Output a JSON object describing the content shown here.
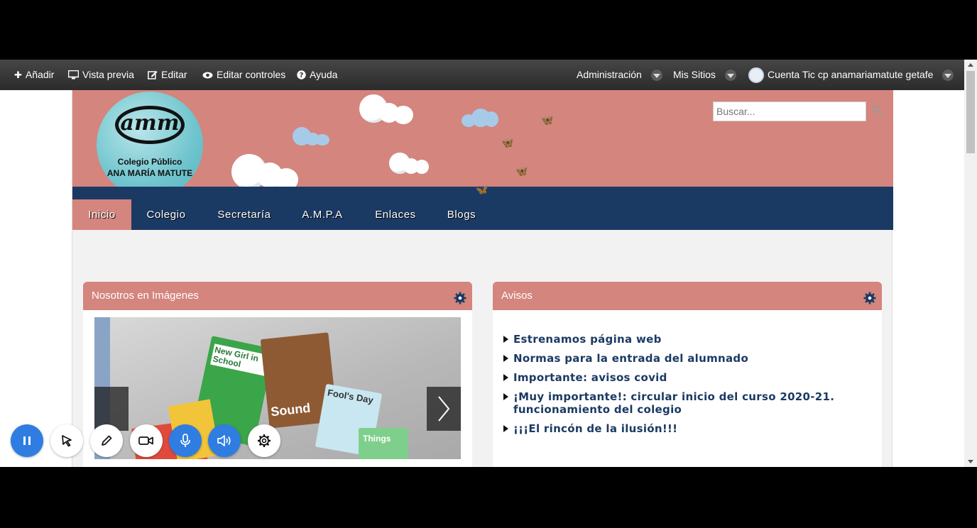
{
  "adminbar": {
    "add": "Añadir",
    "preview": "Vista previa",
    "edit": "Editar",
    "edit_controls": "Editar controles",
    "help": "Ayuda",
    "administration": "Administración",
    "my_sites": "Mis Sitios",
    "account": "Cuenta Tic cp anamariamatute getafe"
  },
  "header": {
    "logo_mark": "amm",
    "logo_line1": "Colegio Público",
    "logo_line2": "ANA MARÍA MATUTE",
    "search_placeholder": "Buscar..."
  },
  "nav": {
    "items": [
      "Inicio",
      "Colegio",
      "Secretaría",
      "A.M.P.A",
      "Enlaces",
      "Blogs"
    ],
    "active": "Inicio"
  },
  "panels": {
    "gallery_title": "Nosotros en Imágenes",
    "avisos_title": "Avisos",
    "avisos": [
      "Estrenamos página web",
      "Normas para la entrada del alumnado",
      "Importante: avisos covid",
      "¡Muy importante!: circular inicio del curso 2020-21. funcionamiento del colegio",
      "¡¡¡El rincón de la ilusión!!!"
    ]
  },
  "gallery_books": [
    "New Girl in School",
    "Sound",
    "Fool's Day",
    "Things"
  ],
  "colors": {
    "header_bg": "#d4857d",
    "nav_bg": "#1b3a63",
    "link": "#1b3a63",
    "toolbar_blue": "#2f7de1"
  }
}
